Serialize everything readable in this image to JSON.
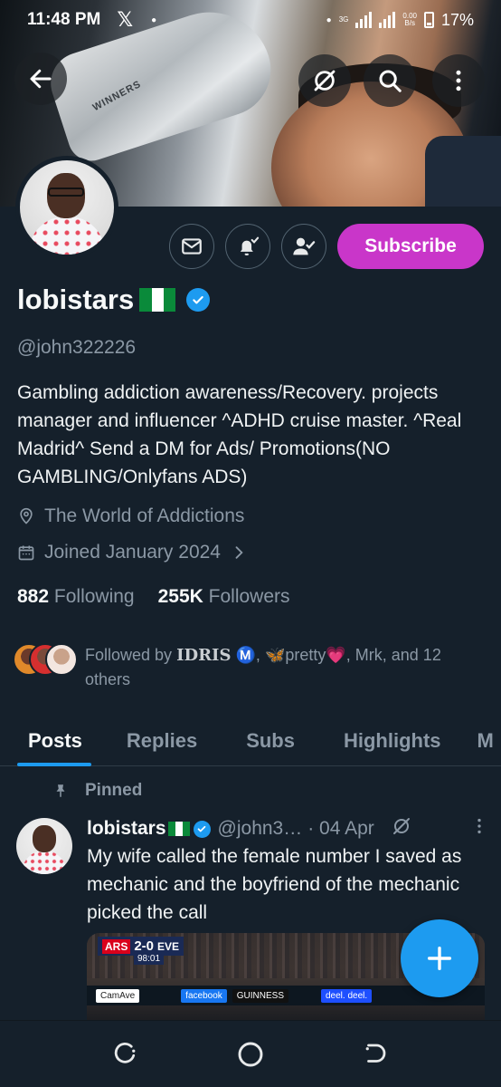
{
  "status_bar": {
    "time": "11:48 PM",
    "app_icon": "x-logo-icon",
    "net_type": "3G",
    "net_speed_top": "0.00",
    "net_speed_bottom": "B/s",
    "battery": "17%"
  },
  "banner": {
    "trophy_text": "WINNERS"
  },
  "top_buttons": [
    "back-arrow-icon",
    "grok-icon",
    "search-icon",
    "more-vertical-icon"
  ],
  "actions": {
    "icons": [
      "mail-icon",
      "bell-notify-icon",
      "follow-check-icon"
    ],
    "subscribe_label": "Subscribe",
    "subscribe_color": "#c936c9"
  },
  "profile": {
    "display_name": "lobistars",
    "handle": "@john322226",
    "bio": "Gambling addiction awareness/Recovery. projects manager and influencer ^ADHD cruise master. ^Real Madrid^ Send a DM for Ads/ Promotions(NO GAMBLING/Onlyfans ADS)",
    "location": "The World of Addictions",
    "joined": "Joined January 2024",
    "following_count": "882",
    "following_label": "Following",
    "followers_count": "255K",
    "followers_label": "Followers"
  },
  "followed_by": {
    "prefix": "Followed by",
    "name1": "IDRIS",
    "name1_badge": "Ⓜ️",
    "name2": "🦋pretty💗",
    "rest": ", Mrk, and 12 others"
  },
  "tabs": [
    "Posts",
    "Replies",
    "Subs",
    "Highlights",
    "M"
  ],
  "post": {
    "pinned_label": "Pinned",
    "name": "lobistars",
    "handle": "@john3…",
    "date": "· 04 Apr",
    "text": "My wife called the female number I saved as mechanic and the boyfriend of the mechanic picked the call",
    "media": {
      "team_home": "ARS",
      "score": "2-0",
      "team_away": "EVE",
      "clock": "98:01",
      "boards": [
        "CamAve",
        "facebook",
        "GUINNESS",
        "deel. deel."
      ]
    }
  },
  "colors": {
    "accent": "#1d9bf0",
    "background": "#15202b",
    "secondary_text": "#8b98a5"
  }
}
